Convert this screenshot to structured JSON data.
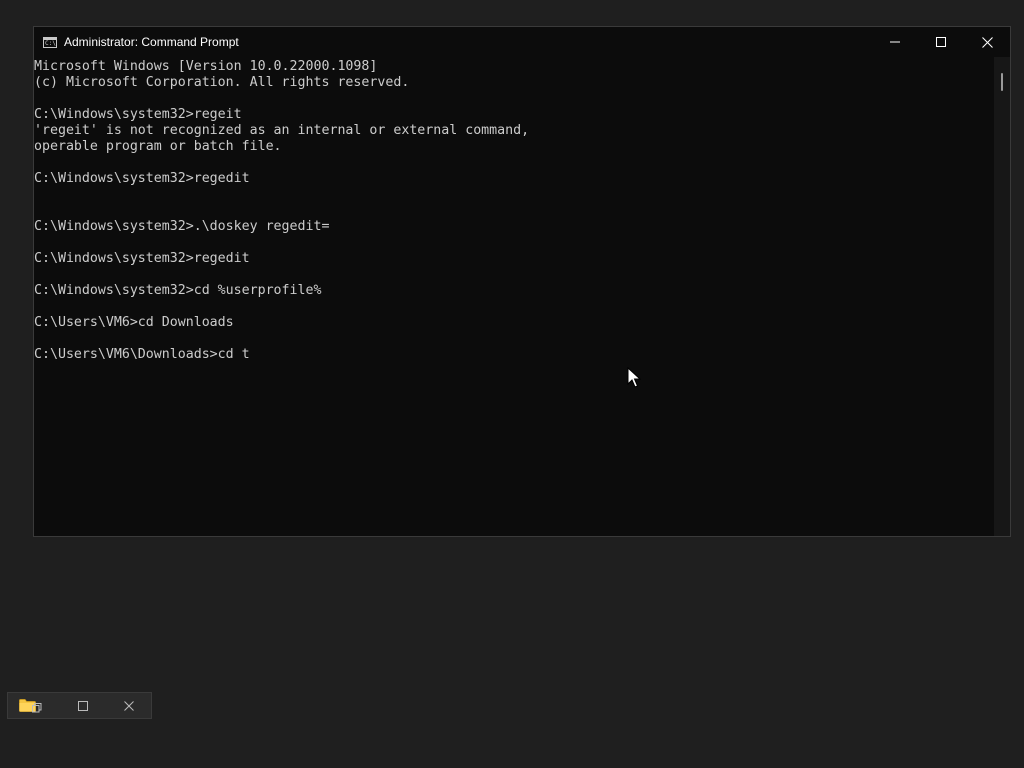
{
  "window": {
    "title": "Administrator: Command Prompt",
    "icon": "cmd-icon",
    "icon_glyph": "C:\\",
    "controls": {
      "minimize": "minimize-icon",
      "maximize": "maximize-icon",
      "close": "close-icon"
    }
  },
  "console": {
    "lines": [
      "Microsoft Windows [Version 10.0.22000.1098]",
      "(c) Microsoft Corporation. All rights reserved.",
      "",
      "C:\\Windows\\system32>regeit",
      "'regeit' is not recognized as an internal or external command,",
      "operable program or batch file.",
      "",
      "C:\\Windows\\system32>regedit",
      "",
      "",
      "C:\\Windows\\system32>.\\doskey regedit=",
      "",
      "C:\\Windows\\system32>regedit",
      "",
      "C:\\Windows\\system32>cd %userprofile%",
      "",
      "C:\\Users\\VM6>cd Downloads",
      "",
      "C:\\Users\\VM6\\Downloads>cd t"
    ]
  },
  "mini_window": {
    "icons": [
      "folder-icon",
      "restore-icon",
      "maximize-icon",
      "close-icon"
    ]
  },
  "colors": {
    "console_bg": "#0c0c0c",
    "console_text": "#cccccc",
    "desktop_bg": "#1f1f1f",
    "folder": "#f5c542"
  }
}
